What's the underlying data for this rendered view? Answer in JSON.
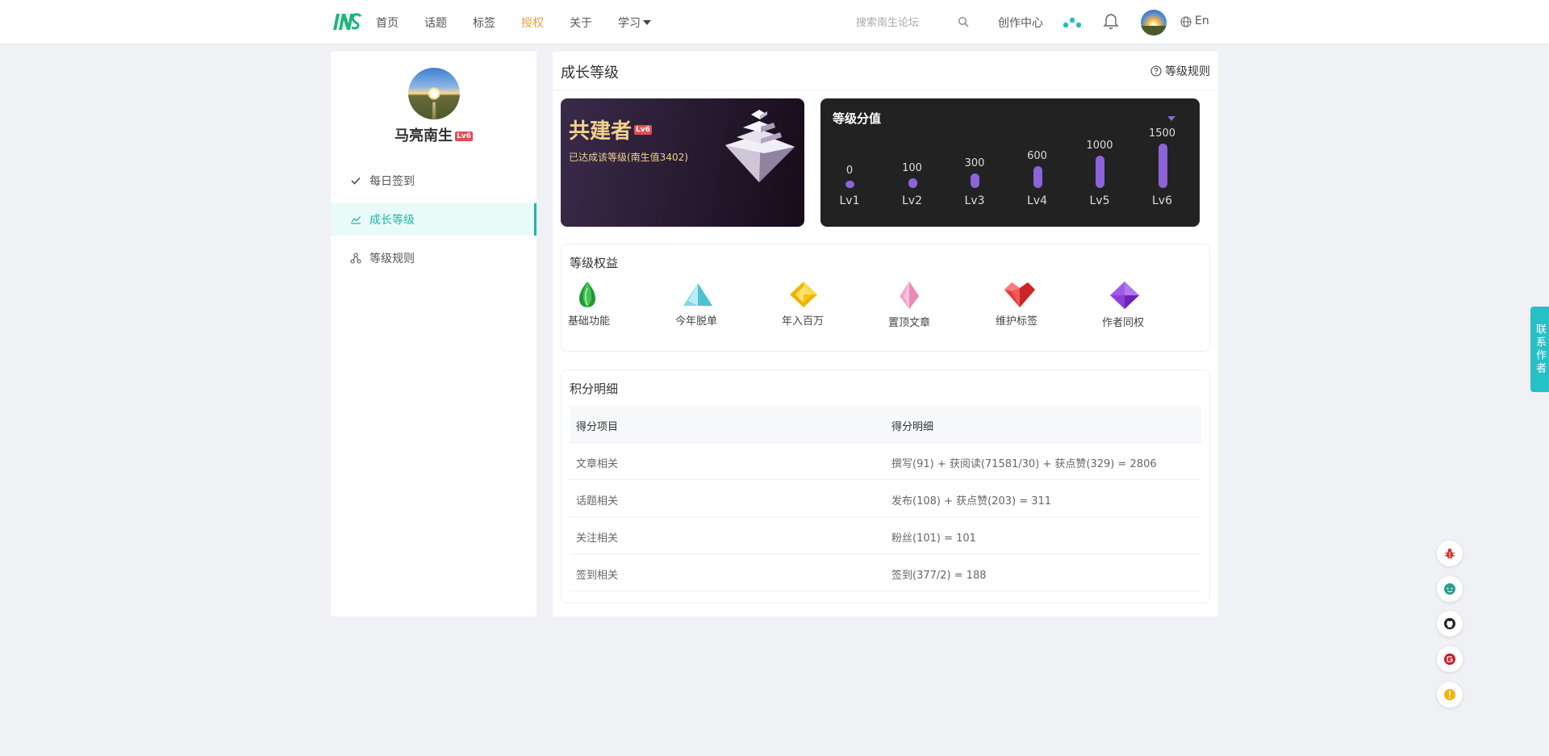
{
  "header": {
    "nav": [
      {
        "label": "首页"
      },
      {
        "label": "话题"
      },
      {
        "label": "标签"
      },
      {
        "label": "授权"
      },
      {
        "label": "关于"
      },
      {
        "label": "学习"
      }
    ],
    "search_placeholder": "搜索南生论坛",
    "create_center": "创作中心",
    "lang": "En",
    "active_nav_color": "#e6a23c"
  },
  "sidebar": {
    "username": "马亮南生",
    "level_badge": "Lv6",
    "menu": [
      {
        "label": "每日签到",
        "icon": "check-icon"
      },
      {
        "label": "成长等级",
        "icon": "trend-icon"
      },
      {
        "label": "等级规则",
        "icon": "nodes-icon"
      }
    ],
    "accent": "#1fb5a8"
  },
  "main": {
    "title": "成长等级",
    "rules_link": "等级规则",
    "level_card": {
      "name": "共建者",
      "badge": "Lv6",
      "desc": "已达成该等级(南生值3402)"
    },
    "score_card": {
      "title": "等级分值",
      "levels": [
        {
          "value": "0",
          "label": "Lv1"
        },
        {
          "value": "100",
          "label": "Lv2"
        },
        {
          "value": "300",
          "label": "Lv3"
        },
        {
          "value": "600",
          "label": "Lv4"
        },
        {
          "value": "1000",
          "label": "Lv5"
        },
        {
          "value": "1500",
          "label": "Lv6"
        }
      ],
      "bar_color": "#8c63d9"
    },
    "benefits": {
      "title": "等级权益",
      "items": [
        {
          "label": "基础功能",
          "icon": "green-drop-gem-icon"
        },
        {
          "label": "今年脱单",
          "icon": "cyan-pyramid-gem-icon"
        },
        {
          "label": "年入百万",
          "icon": "yellow-gem-icon"
        },
        {
          "label": "置顶文章",
          "icon": "pink-crystal-icon"
        },
        {
          "label": "维护标签",
          "icon": "red-heart-gem-icon"
        },
        {
          "label": "作者同权",
          "icon": "purple-gem-icon"
        }
      ]
    },
    "details": {
      "title": "积分明细",
      "headers": [
        "得分项目",
        "得分明细"
      ],
      "rows": [
        [
          "文章相关",
          "撰写(91) + 获阅读(71581/30) + 获点赞(329) = 2806"
        ],
        [
          "话题相关",
          "发布(108) + 获点赞(203) = 311"
        ],
        [
          "关注相关",
          "粉丝(101) = 101"
        ],
        [
          "签到相关",
          "签到(377/2) = 188"
        ]
      ]
    }
  },
  "floating": {
    "contact": "联系作者",
    "buttons": [
      "bug-icon",
      "chat-icon",
      "github-icon",
      "gitee-icon",
      "warning-icon"
    ]
  }
}
